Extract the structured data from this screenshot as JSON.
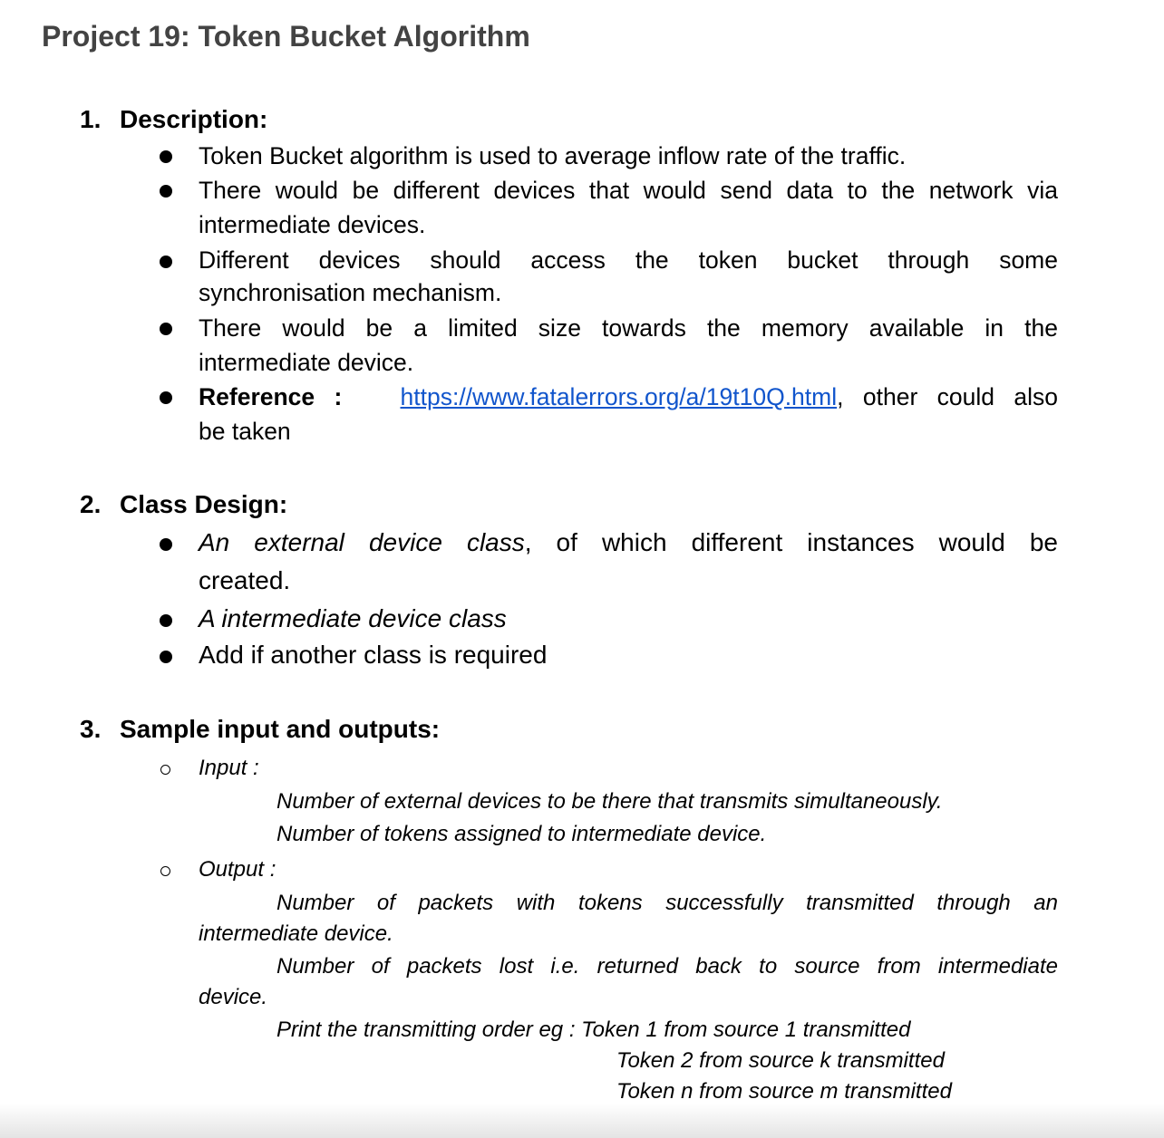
{
  "title": "Project 19: Token Bucket Algorithm",
  "sections": [
    {
      "number": "1.",
      "heading": "Description:",
      "bullets": [
        "Token Bucket algorithm is used to average inflow rate of the traffic.",
        "There would be different devices that would send data to the network via",
        "intermediate devices.",
        "Different devices should access the token bucket through some",
        "synchronisation mechanism.",
        "There would be a limited size towards the memory available in the",
        "intermediate device.",
        "Reference :",
        "https://www.fatalerrors.org/a/19t10Q.html",
        ", other could also",
        "be taken"
      ]
    },
    {
      "number": "2.",
      "heading": "Class Design:",
      "bullets": [
        "An external device class",
        ", of which different instances would be",
        "created.",
        "A intermediate device class",
        "Add if another class is required"
      ]
    },
    {
      "number": "3.",
      "heading": "Sample input and outputs:",
      "input": {
        "label": "Input :",
        "lines": [
          "Number of external devices to be there that transmits simultaneously.",
          "Number of tokens assigned to intermediate device."
        ]
      },
      "output": {
        "label": "Output :",
        "lines": [
          "Number of packets with tokens successfully transmitted through an",
          "intermediate device.",
          "Number of packets lost i.e. returned back to source from intermediate",
          "device.",
          "Print the transmitting order eg : Token 1 from source 1 transmitted",
          "Token 2 from source  k transmitted",
          "Token n from source  m transmitted"
        ]
      }
    }
  ]
}
